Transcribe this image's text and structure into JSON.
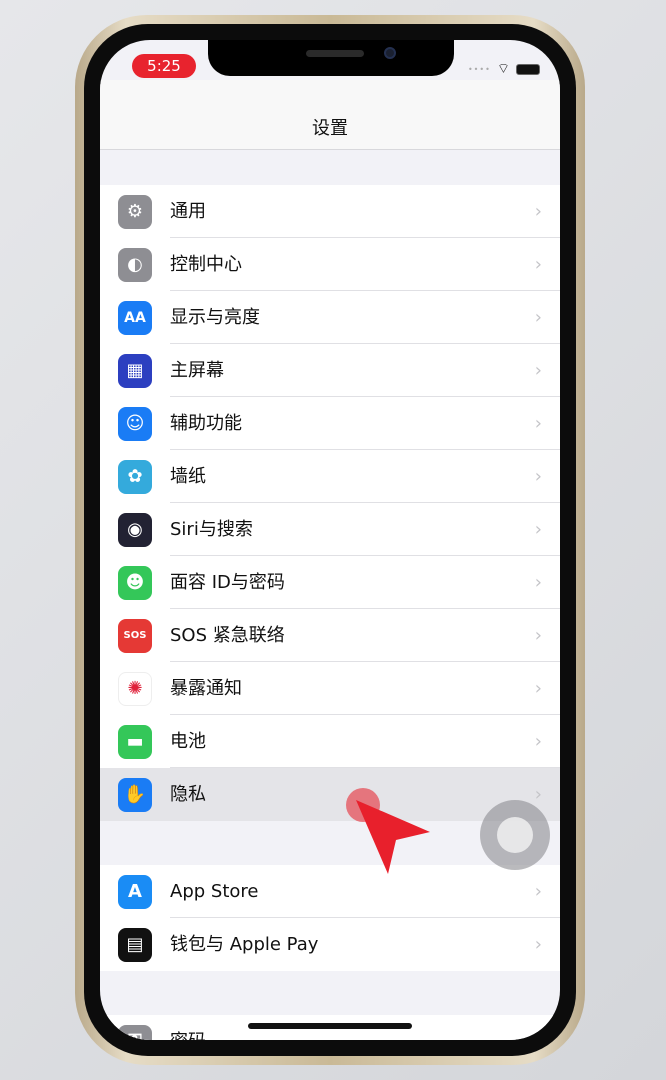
{
  "status": {
    "time": "5:25"
  },
  "header": {
    "title": "设置"
  },
  "groups": [
    {
      "items": [
        {
          "label": "通用",
          "icon": "gear-icon",
          "color": "#8e8e93",
          "glyph": "⚙"
        },
        {
          "label": "控制中心",
          "icon": "toggles-icon",
          "color": "#8e8e93",
          "glyph": "◐"
        },
        {
          "label": "显示与亮度",
          "icon": "text-size-icon",
          "color": "#1a7cf5",
          "glyph": "AA"
        },
        {
          "label": "主屏幕",
          "icon": "home-grid-icon",
          "color": "#2c3fc0",
          "glyph": "▦"
        },
        {
          "label": "辅助功能",
          "icon": "accessibility-icon",
          "color": "#1a7cf5",
          "glyph": "☺"
        },
        {
          "label": "墙纸",
          "icon": "flower-icon",
          "color": "#34aadc",
          "glyph": "✿"
        },
        {
          "label": "Siri与搜索",
          "icon": "siri-icon",
          "color": "#222233",
          "glyph": "◉"
        },
        {
          "label": "面容 ID与密码",
          "icon": "face-id-icon",
          "color": "#34c759",
          "glyph": "☻"
        },
        {
          "label": "SOS 紧急联络",
          "icon": "sos-icon",
          "color": "#e53935",
          "glyph": "SOS"
        },
        {
          "label": "暴露通知",
          "icon": "exposure-icon",
          "color": "#ffffff",
          "glyph": "✺"
        },
        {
          "label": "电池",
          "icon": "battery-icon",
          "color": "#34c759",
          "glyph": "▬"
        },
        {
          "label": "隐私",
          "icon": "hand-icon",
          "color": "#1a7cf5",
          "glyph": "✋"
        }
      ]
    },
    {
      "items": [
        {
          "label": "App Store",
          "icon": "app-store-icon",
          "color": "#1a8cf5",
          "glyph": "A"
        },
        {
          "label": "钱包与 Apple Pay",
          "icon": "wallet-icon",
          "color": "#111111",
          "glyph": "▤"
        }
      ]
    },
    {
      "items": [
        {
          "label": "密码",
          "icon": "key-icon",
          "color": "#8e8e93",
          "glyph": "⚿"
        }
      ]
    }
  ]
}
